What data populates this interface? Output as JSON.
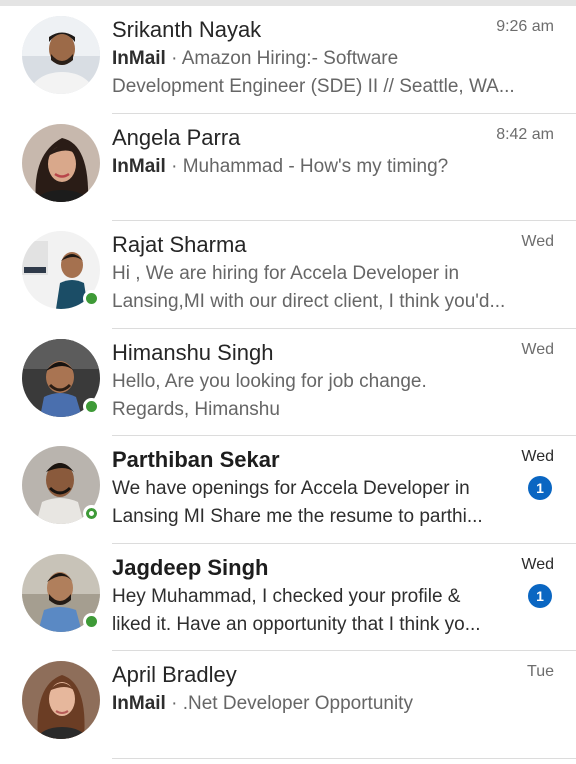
{
  "conversations": [
    {
      "name": "Srikanth Nayak",
      "time": "9:26 am",
      "tag": "InMail",
      "separator": " · ",
      "line1": "Amazon Hiring:- Software",
      "line2": "Development Engineer (SDE) II // Seattle, WA...",
      "unread": false,
      "presence": "none",
      "badge": ""
    },
    {
      "name": "Angela Parra",
      "time": "8:42 am",
      "tag": "InMail",
      "separator": " · ",
      "line1": "Muhammad - How's my timing?",
      "line2": "",
      "unread": false,
      "presence": "none",
      "badge": ""
    },
    {
      "name": "Rajat Sharma",
      "time": "Wed",
      "tag": "",
      "separator": "",
      "line1": "Hi , We are hiring for Accela Developer in",
      "line2": "Lansing,MI with our direct client, I think you'd...",
      "unread": false,
      "presence": "online",
      "badge": ""
    },
    {
      "name": "Himanshu Singh",
      "time": "Wed",
      "tag": "",
      "separator": "",
      "line1": "Hello,  Are you looking for job change.",
      "line2": "Regards, Himanshu",
      "unread": false,
      "presence": "online",
      "badge": ""
    },
    {
      "name": "Parthiban Sekar",
      "time": "Wed",
      "tag": "",
      "separator": "",
      "line1": "We have openings for Accela Developer in",
      "line2": "Lansing MI  Share me the resume to parthi...",
      "unread": true,
      "presence": "away",
      "badge": "1"
    },
    {
      "name": "Jagdeep Singh",
      "time": "Wed",
      "tag": "",
      "separator": "",
      "line1": "Hey Muhammad,  I checked your profile &",
      "line2": "liked it. Have an opportunity that I think yo...",
      "unread": true,
      "presence": "online",
      "badge": "1"
    },
    {
      "name": "April Bradley",
      "time": "Tue",
      "tag": "InMail",
      "separator": " · ",
      "line1": ".Net Developer Opportunity",
      "line2": "",
      "unread": false,
      "presence": "none",
      "badge": ""
    }
  ],
  "colors": {
    "accent": "#0a66c2",
    "online": "#3e9a37"
  },
  "icons": {
    "presence_online": "green-dot-icon",
    "presence_away": "green-ring-icon",
    "unread_badge": "unread-count-badge"
  }
}
